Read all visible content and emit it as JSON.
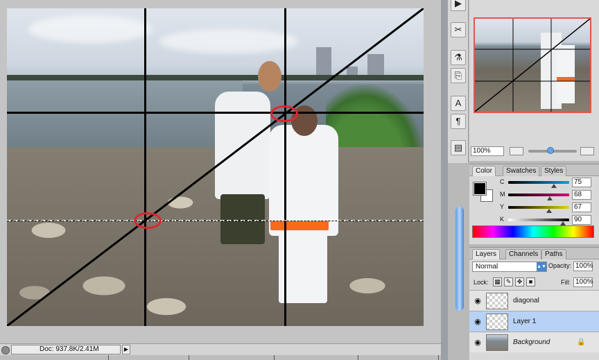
{
  "status_bar": {
    "doc_size": "Doc: 937.8K/2.41M",
    "menu_arrow": "▶"
  },
  "tools": {
    "icons": [
      "play-icon",
      "magic-wand-icon",
      "brush-icon",
      "stamp-icon",
      "character-icon",
      "paragraph-icon",
      "layer-comps-icon"
    ],
    "glyphs": [
      "▶",
      "✂",
      "⚗",
      "⎘",
      "A",
      "¶",
      "▤"
    ]
  },
  "navigator": {
    "zoom": "100%"
  },
  "color_panel": {
    "tabs": [
      "Color",
      "Swatches",
      "Styles"
    ],
    "channels": [
      {
        "label": "C",
        "value": "75",
        "fraction": 0.75,
        "gradient": "linear-gradient(to right,#000,#00a3e0)"
      },
      {
        "label": "M",
        "value": "68",
        "fraction": 0.68,
        "gradient": "linear-gradient(to right,#000,#d4007a)"
      },
      {
        "label": "Y",
        "value": "67",
        "fraction": 0.67,
        "gradient": "linear-gradient(to right,#000,#e6d600)"
      },
      {
        "label": "K",
        "value": "90",
        "fraction": 0.9,
        "gradient": "linear-gradient(to right,#fff,#000)"
      }
    ],
    "foreground": "#000000",
    "background": "#ffffff"
  },
  "layers_panel": {
    "tabs": [
      "Layers",
      "Channels",
      "Paths"
    ],
    "blend_mode": "Normal",
    "opacity_label": "Opacity:",
    "opacity": "100%",
    "lock_label": "Lock:",
    "fill_label": "Fill:",
    "fill": "100%",
    "layers": [
      {
        "name": "diagonal",
        "visible": true,
        "selected": false
      },
      {
        "name": "Layer 1",
        "visible": true,
        "selected": true
      },
      {
        "name": "Background",
        "visible": true,
        "selected": false,
        "locked": true
      }
    ]
  },
  "colors": {
    "guide": "#000000",
    "marker": "#e3242b",
    "selection": "#b7d2f4"
  }
}
